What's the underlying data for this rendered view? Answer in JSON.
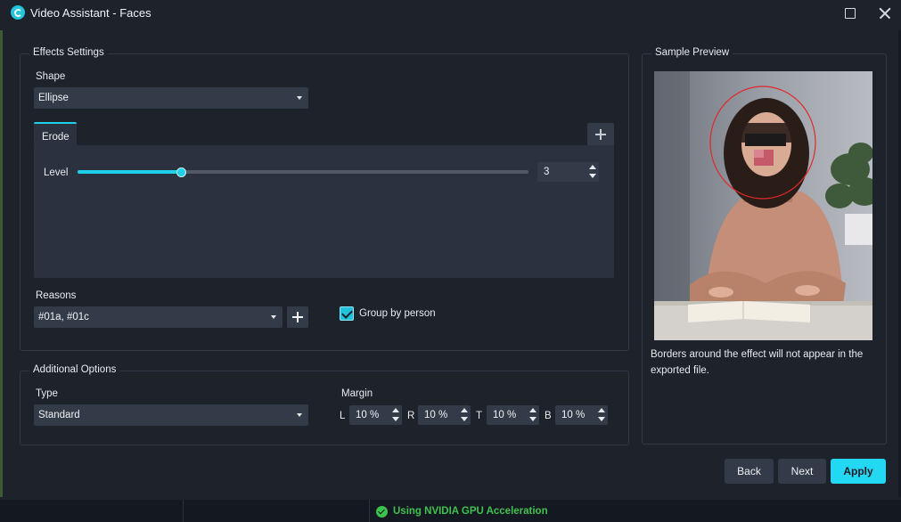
{
  "window": {
    "title": "Video Assistant - Faces"
  },
  "effects": {
    "legend": "Effects Settings",
    "shape_label": "Shape",
    "shape_value": "Ellipse",
    "tab_label": "Erode",
    "level_label": "Level",
    "level_value": "3",
    "level_fraction": 0.23,
    "reasons_label": "Reasons",
    "reasons_value": "#01a, #01c",
    "group_by_person_label": "Group by person",
    "group_by_person_checked": true
  },
  "additional": {
    "legend": "Additional Options",
    "type_label": "Type",
    "type_value": "Standard",
    "margin_label": "Margin",
    "margins": [
      {
        "side": "L",
        "value": "10 %"
      },
      {
        "side": "R",
        "value": "10 %"
      },
      {
        "side": "T",
        "value": "10 %"
      },
      {
        "side": "B",
        "value": "10 %"
      }
    ]
  },
  "preview": {
    "legend": "Sample Preview",
    "note": "Borders around the effect will not appear in the exported file."
  },
  "buttons": {
    "back": "Back",
    "next": "Next",
    "apply": "Apply"
  },
  "status": {
    "gpu_text": "Using NVIDIA GPU Acceleration"
  },
  "colors": {
    "accent": "#1fd0ea",
    "background": "#1d222b",
    "panel": "#2b313e",
    "field": "#343b48",
    "status_green": "#3cc24f"
  }
}
